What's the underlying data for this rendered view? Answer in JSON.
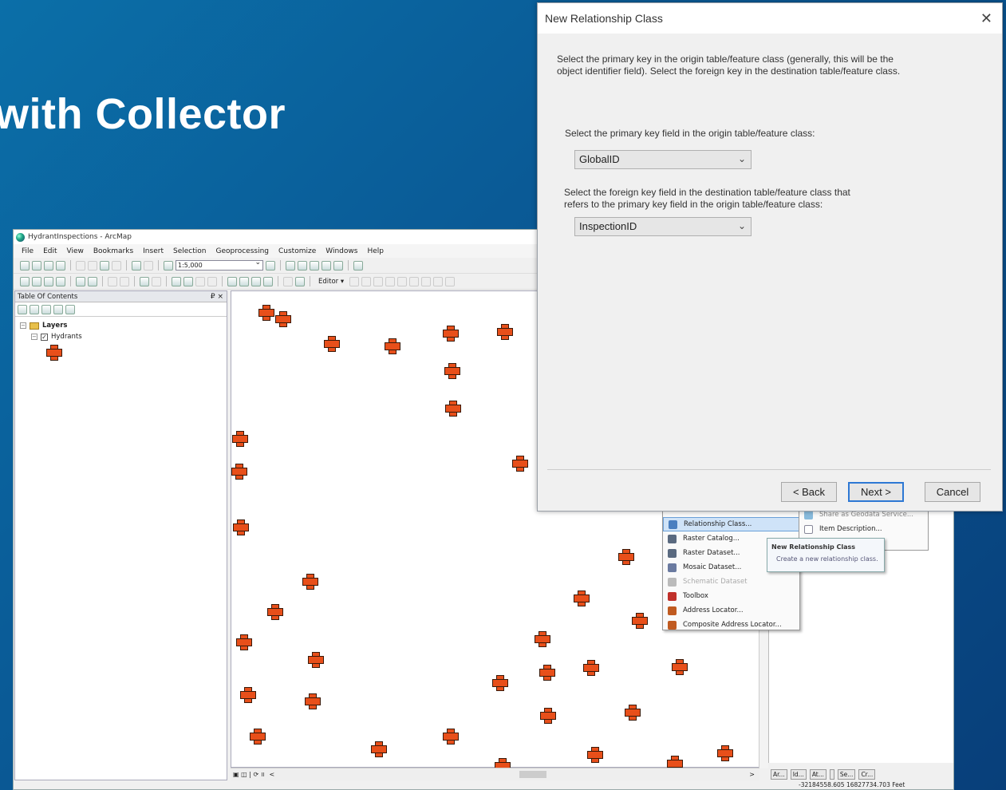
{
  "slide": {
    "title": "with Collector"
  },
  "arcmap": {
    "window_title": "HydrantInspections - ArcMap",
    "menu": [
      "File",
      "Edit",
      "View",
      "Bookmarks",
      "Insert",
      "Selection",
      "Geoprocessing",
      "Customize",
      "Windows",
      "Help"
    ],
    "scale": "1:5,000",
    "editor_label": "Editor ▾",
    "toc": {
      "title": "Table Of Contents",
      "pin": "₽ ×",
      "layers_label": "Layers",
      "layer_name": "Hydrants"
    },
    "statusbar": {
      "tasks": [
        "Ar...",
        "Id...",
        "At...",
        "",
        "Se...",
        "Cr..."
      ],
      "coordinates": "-32184558.605  16827734.703 Feet"
    },
    "map_footer": [
      "▣ ◫ | ⟳ ॥",
      "<",
      ">"
    ]
  },
  "context_menu": {
    "items": [
      {
        "label": "Relationship Class...",
        "icon": "relationship-icon",
        "color": "#4a7fc0",
        "selected": true
      },
      {
        "label": "Raster Catalog...",
        "icon": "raster-catalog-icon",
        "color": "#5a6a80"
      },
      {
        "label": "Raster Dataset...",
        "icon": "raster-dataset-icon",
        "color": "#5a6a80"
      },
      {
        "label": "Mosaic Dataset...",
        "icon": "mosaic-icon",
        "color": "#6a7aa0"
      },
      {
        "label": "Schematic Dataset",
        "icon": "schematic-icon",
        "color": "#bbb",
        "disabled": true
      },
      {
        "label": "Toolbox",
        "icon": "toolbox-icon",
        "color": "#c0302a"
      },
      {
        "label": "Address Locator...",
        "icon": "locator-icon",
        "color": "#c05a20"
      },
      {
        "label": "Composite Address Locator...",
        "icon": "composite-locator-icon",
        "color": "#c05a20"
      }
    ],
    "secondary": [
      "Share as Geodata Service...",
      "Item Description..."
    ],
    "tooltip": {
      "title": "New Relationship Class",
      "body": "Create a new relationship class."
    }
  },
  "dialog": {
    "title": "New Relationship Class",
    "close": "✕",
    "intro": "Select the primary key in the origin table/feature class (generally, this will be the object identifier field). Select the foreign key in the destination table/feature class.",
    "primary_label": "Select the primary key field in the origin table/feature class:",
    "primary_value": "GlobalID",
    "foreign_label": "Select the foreign key field in the destination table/feature class that refers to the primary key field in the origin table/feature class:",
    "foreign_value": "InspectionID",
    "back": "< Back",
    "next": "Next >",
    "cancel": "Cancel"
  }
}
